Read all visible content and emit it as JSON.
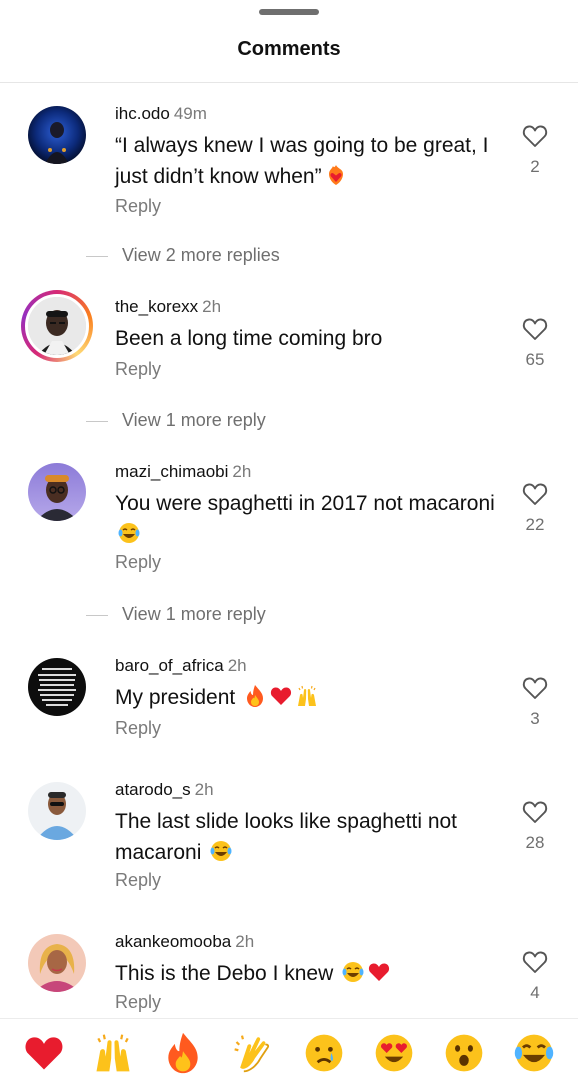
{
  "header": {
    "title": "Comments"
  },
  "comments": [
    {
      "username": "ihc.odo",
      "time": "49m",
      "text": "“I always knew I was going to be great, I just didn’t know when”",
      "emoji": [
        "heart-on-fire"
      ],
      "reply": "Reply",
      "likes": "2",
      "view_more": "View 2 more replies"
    },
    {
      "username": "the_korexx",
      "time": "2h",
      "text": "Been a long time coming bro",
      "emoji": [],
      "reply": "Reply",
      "likes": "65",
      "view_more": "View 1 more reply"
    },
    {
      "username": "mazi_chimaobi",
      "time": "2h",
      "text": "You were spaghetti in 2017 not macaroni",
      "emoji": [
        "tears-of-joy"
      ],
      "reply": "Reply",
      "likes": "22",
      "view_more": "View 1 more reply"
    },
    {
      "username": "baro_of_africa",
      "time": "2h",
      "text": "My president ",
      "emoji": [
        "fire",
        "red-heart",
        "raising-hands"
      ],
      "reply": "Reply",
      "likes": "3"
    },
    {
      "username": "atarodo_s",
      "time": "2h",
      "text": "The last slide looks like spaghetti not macaroni ",
      "emoji": [
        "tears-of-joy"
      ],
      "reply": "Reply",
      "likes": "28"
    },
    {
      "username": "akankeomooba",
      "time": "2h",
      "text": "This is the Debo I knew ",
      "emoji": [
        "tears-of-joy",
        "red-heart"
      ],
      "reply": "Reply",
      "likes": "4"
    }
  ],
  "reaction_bar": [
    "red-heart",
    "raising-hands",
    "fire",
    "clapping-hands",
    "crying-face",
    "heart-eyes",
    "surprised-face",
    "tears-of-joy"
  ],
  "colors": {
    "text": "#111111",
    "muted": "#7a7a7a",
    "divider": "#e6e6e6",
    "story_ring": "#d62976"
  }
}
